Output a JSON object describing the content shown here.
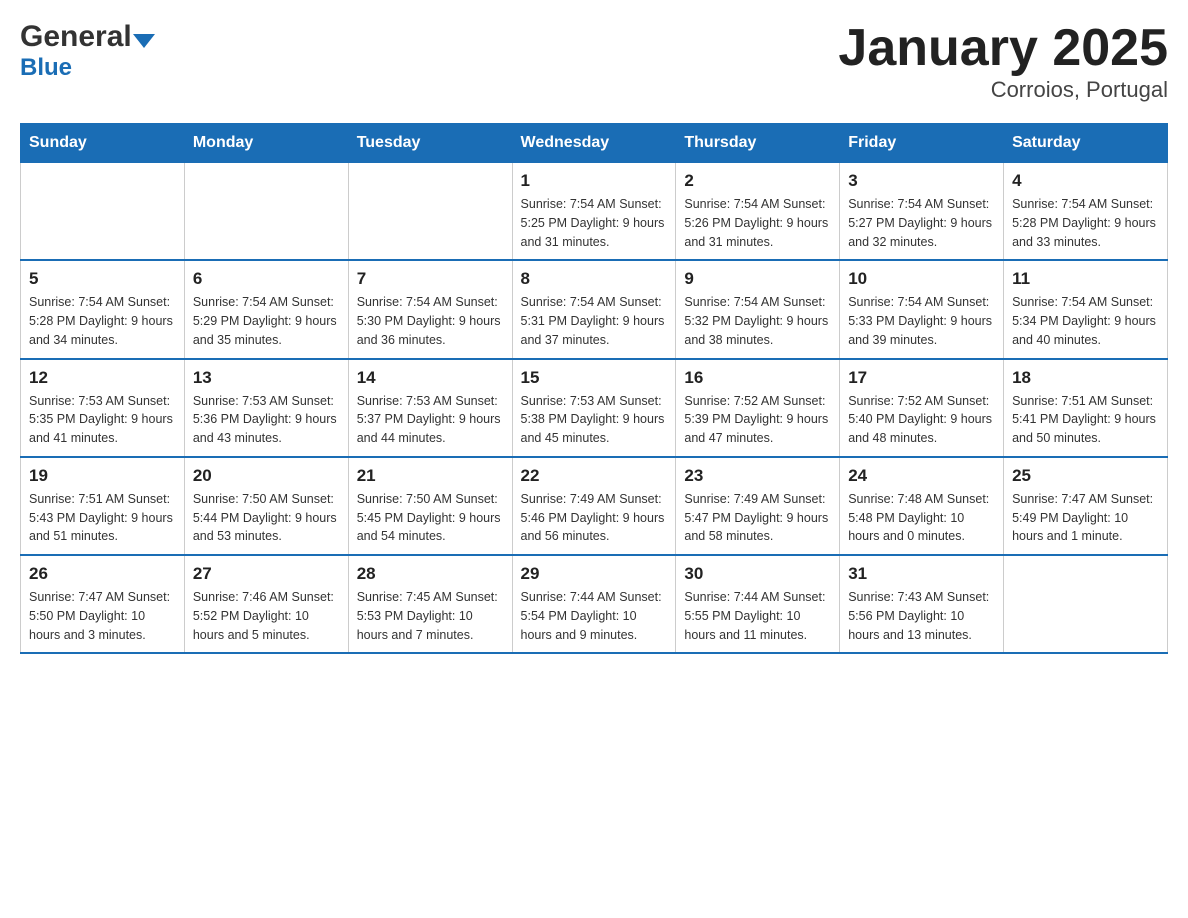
{
  "header": {
    "logo_general": "General",
    "logo_blue": "Blue",
    "title": "January 2025",
    "subtitle": "Corroios, Portugal"
  },
  "days_of_week": [
    "Sunday",
    "Monday",
    "Tuesday",
    "Wednesday",
    "Thursday",
    "Friday",
    "Saturday"
  ],
  "weeks": [
    [
      {
        "day": "",
        "info": ""
      },
      {
        "day": "",
        "info": ""
      },
      {
        "day": "",
        "info": ""
      },
      {
        "day": "1",
        "info": "Sunrise: 7:54 AM\nSunset: 5:25 PM\nDaylight: 9 hours\nand 31 minutes."
      },
      {
        "day": "2",
        "info": "Sunrise: 7:54 AM\nSunset: 5:26 PM\nDaylight: 9 hours\nand 31 minutes."
      },
      {
        "day": "3",
        "info": "Sunrise: 7:54 AM\nSunset: 5:27 PM\nDaylight: 9 hours\nand 32 minutes."
      },
      {
        "day": "4",
        "info": "Sunrise: 7:54 AM\nSunset: 5:28 PM\nDaylight: 9 hours\nand 33 minutes."
      }
    ],
    [
      {
        "day": "5",
        "info": "Sunrise: 7:54 AM\nSunset: 5:28 PM\nDaylight: 9 hours\nand 34 minutes."
      },
      {
        "day": "6",
        "info": "Sunrise: 7:54 AM\nSunset: 5:29 PM\nDaylight: 9 hours\nand 35 minutes."
      },
      {
        "day": "7",
        "info": "Sunrise: 7:54 AM\nSunset: 5:30 PM\nDaylight: 9 hours\nand 36 minutes."
      },
      {
        "day": "8",
        "info": "Sunrise: 7:54 AM\nSunset: 5:31 PM\nDaylight: 9 hours\nand 37 minutes."
      },
      {
        "day": "9",
        "info": "Sunrise: 7:54 AM\nSunset: 5:32 PM\nDaylight: 9 hours\nand 38 minutes."
      },
      {
        "day": "10",
        "info": "Sunrise: 7:54 AM\nSunset: 5:33 PM\nDaylight: 9 hours\nand 39 minutes."
      },
      {
        "day": "11",
        "info": "Sunrise: 7:54 AM\nSunset: 5:34 PM\nDaylight: 9 hours\nand 40 minutes."
      }
    ],
    [
      {
        "day": "12",
        "info": "Sunrise: 7:53 AM\nSunset: 5:35 PM\nDaylight: 9 hours\nand 41 minutes."
      },
      {
        "day": "13",
        "info": "Sunrise: 7:53 AM\nSunset: 5:36 PM\nDaylight: 9 hours\nand 43 minutes."
      },
      {
        "day": "14",
        "info": "Sunrise: 7:53 AM\nSunset: 5:37 PM\nDaylight: 9 hours\nand 44 minutes."
      },
      {
        "day": "15",
        "info": "Sunrise: 7:53 AM\nSunset: 5:38 PM\nDaylight: 9 hours\nand 45 minutes."
      },
      {
        "day": "16",
        "info": "Sunrise: 7:52 AM\nSunset: 5:39 PM\nDaylight: 9 hours\nand 47 minutes."
      },
      {
        "day": "17",
        "info": "Sunrise: 7:52 AM\nSunset: 5:40 PM\nDaylight: 9 hours\nand 48 minutes."
      },
      {
        "day": "18",
        "info": "Sunrise: 7:51 AM\nSunset: 5:41 PM\nDaylight: 9 hours\nand 50 minutes."
      }
    ],
    [
      {
        "day": "19",
        "info": "Sunrise: 7:51 AM\nSunset: 5:43 PM\nDaylight: 9 hours\nand 51 minutes."
      },
      {
        "day": "20",
        "info": "Sunrise: 7:50 AM\nSunset: 5:44 PM\nDaylight: 9 hours\nand 53 minutes."
      },
      {
        "day": "21",
        "info": "Sunrise: 7:50 AM\nSunset: 5:45 PM\nDaylight: 9 hours\nand 54 minutes."
      },
      {
        "day": "22",
        "info": "Sunrise: 7:49 AM\nSunset: 5:46 PM\nDaylight: 9 hours\nand 56 minutes."
      },
      {
        "day": "23",
        "info": "Sunrise: 7:49 AM\nSunset: 5:47 PM\nDaylight: 9 hours\nand 58 minutes."
      },
      {
        "day": "24",
        "info": "Sunrise: 7:48 AM\nSunset: 5:48 PM\nDaylight: 10 hours\nand 0 minutes."
      },
      {
        "day": "25",
        "info": "Sunrise: 7:47 AM\nSunset: 5:49 PM\nDaylight: 10 hours\nand 1 minute."
      }
    ],
    [
      {
        "day": "26",
        "info": "Sunrise: 7:47 AM\nSunset: 5:50 PM\nDaylight: 10 hours\nand 3 minutes."
      },
      {
        "day": "27",
        "info": "Sunrise: 7:46 AM\nSunset: 5:52 PM\nDaylight: 10 hours\nand 5 minutes."
      },
      {
        "day": "28",
        "info": "Sunrise: 7:45 AM\nSunset: 5:53 PM\nDaylight: 10 hours\nand 7 minutes."
      },
      {
        "day": "29",
        "info": "Sunrise: 7:44 AM\nSunset: 5:54 PM\nDaylight: 10 hours\nand 9 minutes."
      },
      {
        "day": "30",
        "info": "Sunrise: 7:44 AM\nSunset: 5:55 PM\nDaylight: 10 hours\nand 11 minutes."
      },
      {
        "day": "31",
        "info": "Sunrise: 7:43 AM\nSunset: 5:56 PM\nDaylight: 10 hours\nand 13 minutes."
      },
      {
        "day": "",
        "info": ""
      }
    ]
  ]
}
